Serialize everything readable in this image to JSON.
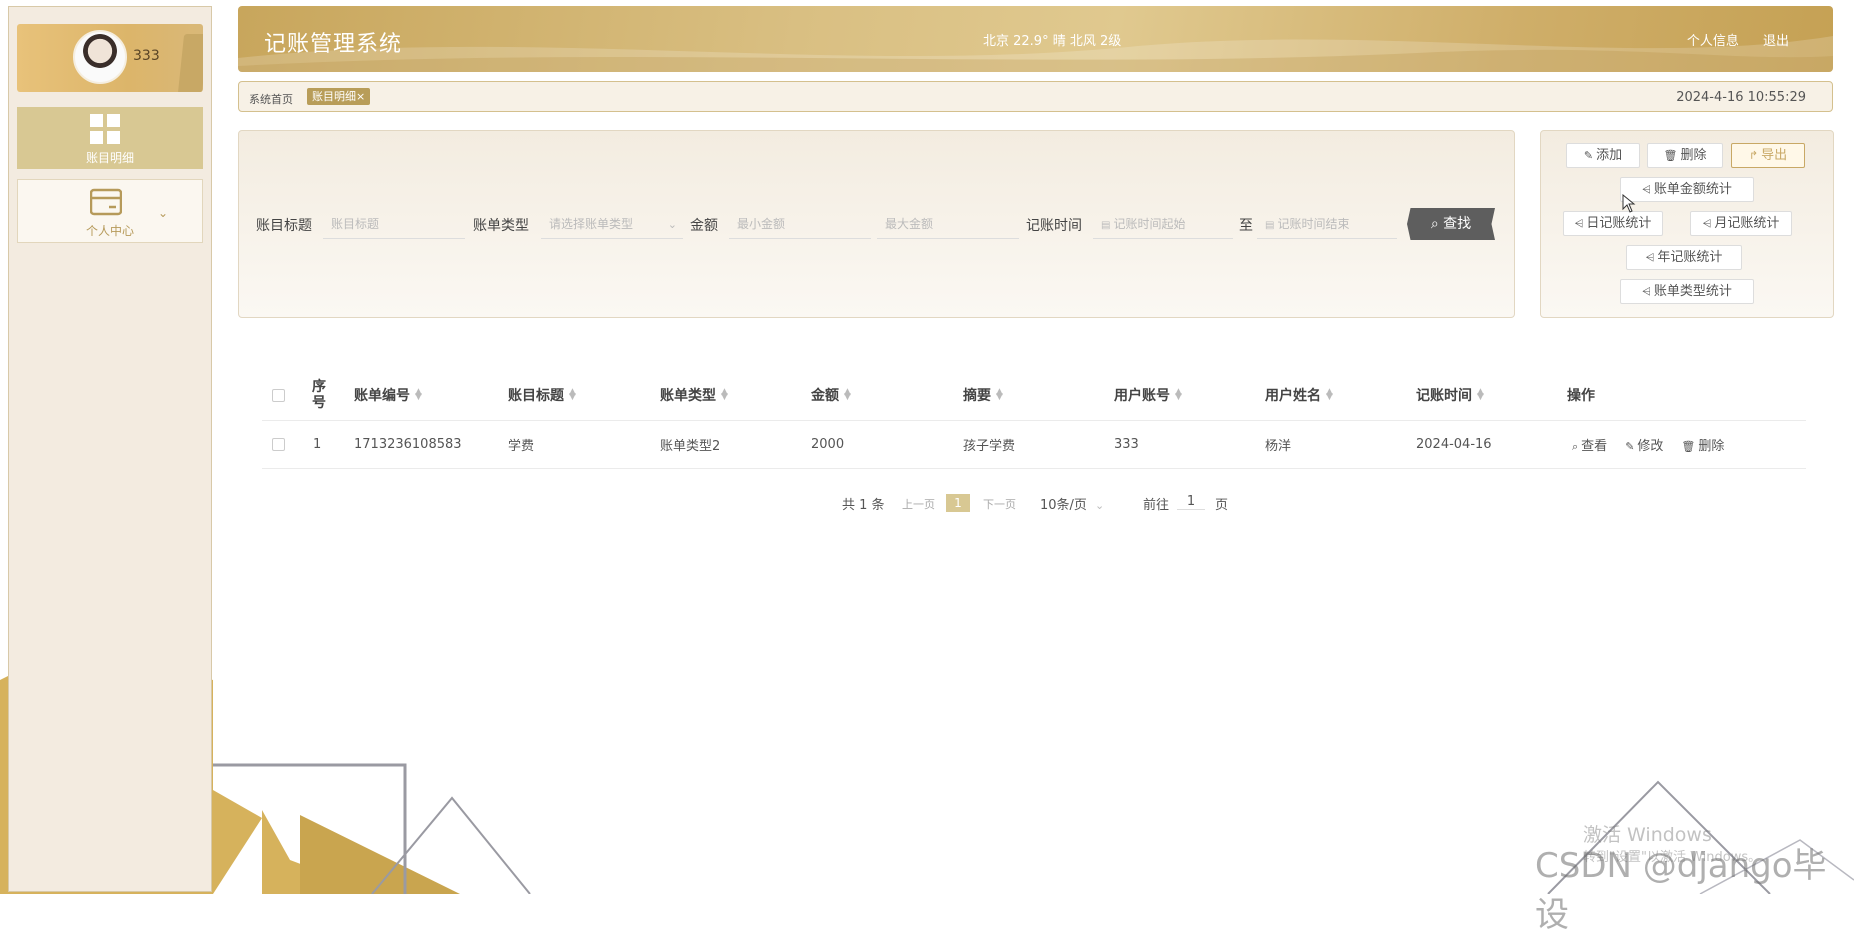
{
  "sidebar": {
    "username": "333",
    "items": [
      {
        "label": "账目明细",
        "icon": "grid-icon"
      },
      {
        "label": "个人中心",
        "icon": "card-icon"
      }
    ]
  },
  "header": {
    "title": "记账管理系统",
    "weather": "北京 22.9° 晴 北风 2级",
    "links": [
      "个人信息",
      "退出"
    ]
  },
  "breadcrumb": {
    "home": "系统首页",
    "current": "账目明细×",
    "datetime": "2024-4-16 10:55:29"
  },
  "search": {
    "fields": [
      {
        "label": "账目标题",
        "placeholder": "账目标题"
      },
      {
        "label": "账单类型",
        "placeholder": "请选择账单类型"
      },
      {
        "label": "金额",
        "placeholder_min": "最小金额",
        "placeholder_max": "最大金额"
      },
      {
        "label": "记账时间",
        "placeholder_start": "记账时间起始",
        "separator": "至",
        "placeholder_end": "记账时间结束"
      }
    ],
    "button": "查找"
  },
  "actions": {
    "add": "添加",
    "delete": "删除",
    "export": "导出",
    "bill_amount_stats": "账单金额统计",
    "daily_stats": "日记账统计",
    "monthly_stats": "月记账统计",
    "yearly_stats": "年记账统计",
    "bill_type_stats": "账单类型统计"
  },
  "table": {
    "columns": [
      "序号",
      "账单编号",
      "账目标题",
      "账单类型",
      "金额",
      "摘要",
      "用户账号",
      "用户姓名",
      "记账时间",
      "操作"
    ],
    "rows": [
      {
        "index": "1",
        "bill_no": "1713236108583",
        "title": "学费",
        "type": "账单类型2",
        "amount": "2000",
        "summary": "孩子学费",
        "account": "333",
        "name": "杨洋",
        "date": "2024-04-16"
      }
    ],
    "row_actions": [
      "查看",
      "修改",
      "删除"
    ]
  },
  "pagination": {
    "total": "共 1 条",
    "prev": "上一页",
    "page": "1",
    "next": "下一页",
    "page_size": "10条/页",
    "goto_label": "前往",
    "goto_value": "1",
    "goto_suffix": "页"
  },
  "overlay": {
    "activation": "激活 Windows",
    "activation_sub": "转到\"设置\"以激活 Windows。",
    "credit": "CSDN @django毕设"
  },
  "colors": {
    "accent": "#c8a65c",
    "sidebar_bg": "#f3ebe0",
    "active_menu": "#d8c893"
  }
}
